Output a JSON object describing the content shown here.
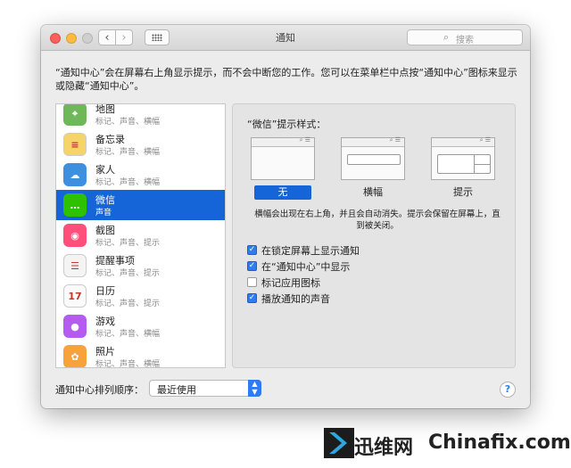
{
  "window": {
    "title": "通知",
    "search_placeholder": "搜索"
  },
  "description": "“通知中心”会在屏幕右上角显示提示，而不会中断您的工作。您可以在菜单栏中点按“通知中心”图标来显示或隐藏“通知中心”。",
  "apps": [
    {
      "name": "地图",
      "sub": "标记、声音、横幅",
      "icon": "map-icon",
      "color": "#6fb85a",
      "glyph": "⌖"
    },
    {
      "name": "备忘录",
      "sub": "标记、声音、横幅",
      "icon": "notes-icon",
      "color": "#f5d56a",
      "glyph": "≡"
    },
    {
      "name": "家人",
      "sub": "标记、声音、横幅",
      "icon": "family-icon",
      "color": "#3d8fdf",
      "glyph": "☁"
    },
    {
      "name": "微信",
      "sub": "声音",
      "icon": "wechat-icon",
      "color": "#2dc100",
      "glyph": "…"
    },
    {
      "name": "截图",
      "sub": "标记、声音、提示",
      "icon": "screenshot-icon",
      "color": "#ff4f7a",
      "glyph": "◉"
    },
    {
      "name": "提醒事项",
      "sub": "标记、声音、提示",
      "icon": "reminders-icon",
      "color": "#f4f4f4",
      "glyph": "☰"
    },
    {
      "name": "日历",
      "sub": "标记、声音、提示",
      "icon": "calendar-icon",
      "color": "#fafafa",
      "glyph": "17"
    },
    {
      "name": "游戏",
      "sub": "标记、声音、横幅",
      "icon": "game-center-icon",
      "color": "#b55cf0",
      "glyph": "●"
    },
    {
      "name": "照片",
      "sub": "标记、声音、横幅",
      "icon": "photos-icon",
      "color": "#f7a23a",
      "glyph": "✿"
    }
  ],
  "selected_app_index": 3,
  "style": {
    "title": "“微信”提示样式：",
    "options": [
      "无",
      "横幅",
      "提示"
    ],
    "selected": "无",
    "description": "横幅会出现在右上角，并且会自动消失。提示会保留在屏幕上，直到被关闭。"
  },
  "options": [
    {
      "label": "在锁定屏幕上显示通知",
      "checked": true
    },
    {
      "label": "在“通知中心”中显示",
      "checked": true
    },
    {
      "label": "标记应用图标",
      "checked": false
    },
    {
      "label": "播放通知的声音",
      "checked": true
    }
  ],
  "sort": {
    "label": "通知中心排列顺序：",
    "value": "最近使用"
  },
  "help": "?",
  "watermark": {
    "brand": "迅维网",
    "domain": "Chinafix.com",
    "color": "#2aa8df"
  },
  "colors": {
    "selection": "#1665d8",
    "checkbox": "#2f7cf1"
  }
}
